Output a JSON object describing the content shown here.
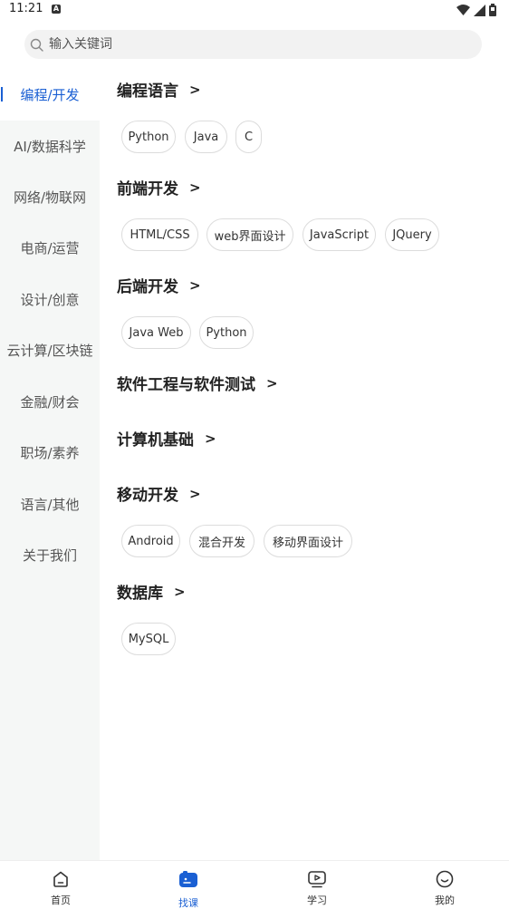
{
  "status_bar": {
    "time": "11:21",
    "notification_letter": "A"
  },
  "search": {
    "placeholder": "输入关键词"
  },
  "sidebar": {
    "items": [
      {
        "label": "编程/开发",
        "active": true
      },
      {
        "label": "AI/数据科学"
      },
      {
        "label": "网络/物联网"
      },
      {
        "label": "电商/运营"
      },
      {
        "label": "设计/创意"
      },
      {
        "label": "云计算/区块链"
      },
      {
        "label": "金融/财会"
      },
      {
        "label": "职场/素养"
      },
      {
        "label": "语言/其他"
      },
      {
        "label": "关于我们"
      }
    ]
  },
  "sections": [
    {
      "title": "编程语言",
      "tags": [
        "Python",
        "Java",
        "C"
      ]
    },
    {
      "title": "前端开发",
      "tags": [
        "HTML/CSS",
        "web界面设计",
        "JavaScript",
        "JQuery"
      ]
    },
    {
      "title": "后端开发",
      "tags": [
        "Java Web",
        "Python"
      ]
    },
    {
      "title": "软件工程与软件测试",
      "tags": []
    },
    {
      "title": "计算机基础",
      "tags": []
    },
    {
      "title": "移动开发",
      "tags": [
        "Android",
        "混合开发",
        "移动界面设计"
      ]
    },
    {
      "title": "数据库",
      "tags": [
        "MySQL"
      ]
    }
  ],
  "bottom_nav": {
    "items": [
      {
        "label": "首页",
        "icon": "home-icon"
      },
      {
        "label": "找课",
        "icon": "find-course-icon",
        "active": true
      },
      {
        "label": "学习",
        "icon": "study-icon"
      },
      {
        "label": "我的",
        "icon": "profile-icon"
      }
    ]
  },
  "colors": {
    "accent": "#1a5fd3",
    "sidebar_bg": "#f5f7f6",
    "search_bg": "#f2f2f2",
    "chip_border": "#dcdcdc"
  }
}
